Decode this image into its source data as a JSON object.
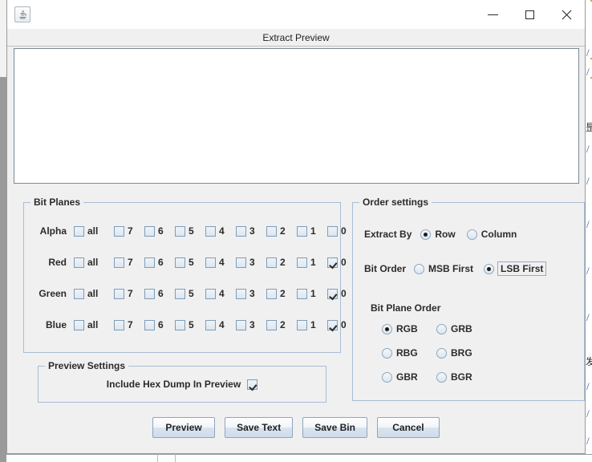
{
  "window": {
    "app_icon": "java-coffee-cup-icon",
    "dialog_title": "Extract Preview",
    "controls": {
      "minimize": "minimize-button",
      "maximize": "maximize-button",
      "close": "close-button"
    }
  },
  "preview": {
    "text": ""
  },
  "bit_planes": {
    "legend": "Bit Planes",
    "columns": [
      "all",
      "7",
      "6",
      "5",
      "4",
      "3",
      "2",
      "1",
      "0"
    ],
    "rows": [
      {
        "label": "Alpha",
        "checked": [
          false,
          false,
          false,
          false,
          false,
          false,
          false,
          false,
          false
        ]
      },
      {
        "label": "Red",
        "checked": [
          false,
          false,
          false,
          false,
          false,
          false,
          false,
          false,
          true
        ]
      },
      {
        "label": "Green",
        "checked": [
          false,
          false,
          false,
          false,
          false,
          false,
          false,
          false,
          true
        ]
      },
      {
        "label": "Blue",
        "checked": [
          false,
          false,
          false,
          false,
          false,
          false,
          false,
          false,
          true
        ]
      }
    ]
  },
  "order_settings": {
    "legend": "Order settings",
    "extract_by": {
      "label": "Extract By",
      "options": [
        "Row",
        "Column"
      ],
      "selected": "Row"
    },
    "bit_order": {
      "label": "Bit Order",
      "options": [
        "MSB First",
        "LSB First"
      ],
      "selected": "LSB First",
      "focused": "LSB First"
    },
    "bit_plane_order": {
      "label": "Bit Plane Order",
      "options": [
        "RGB",
        "GRB",
        "RBG",
        "BRG",
        "GBR",
        "BGR"
      ],
      "selected": "RGB"
    }
  },
  "preview_settings": {
    "legend": "Preview Settings",
    "include_hex_dump": {
      "label": "Include Hex Dump In Preview",
      "checked": true
    }
  },
  "buttons": [
    {
      "label": "Preview"
    },
    {
      "label": "Save Text"
    },
    {
      "label": "Save Bin"
    },
    {
      "label": "Cancel"
    }
  ],
  "background": {
    "right_edge_glyphs": [
      "/",
      "/",
      "昰",
      "/",
      "/",
      "/",
      "/",
      "发",
      "/",
      "/",
      "/"
    ]
  },
  "colors": {
    "window_bg": "#f0f0f0",
    "panel_border": "#a9bcd4",
    "text": "#2b2b2b",
    "control_border": "#7f9db9",
    "button_face": "#d9e4f0"
  }
}
